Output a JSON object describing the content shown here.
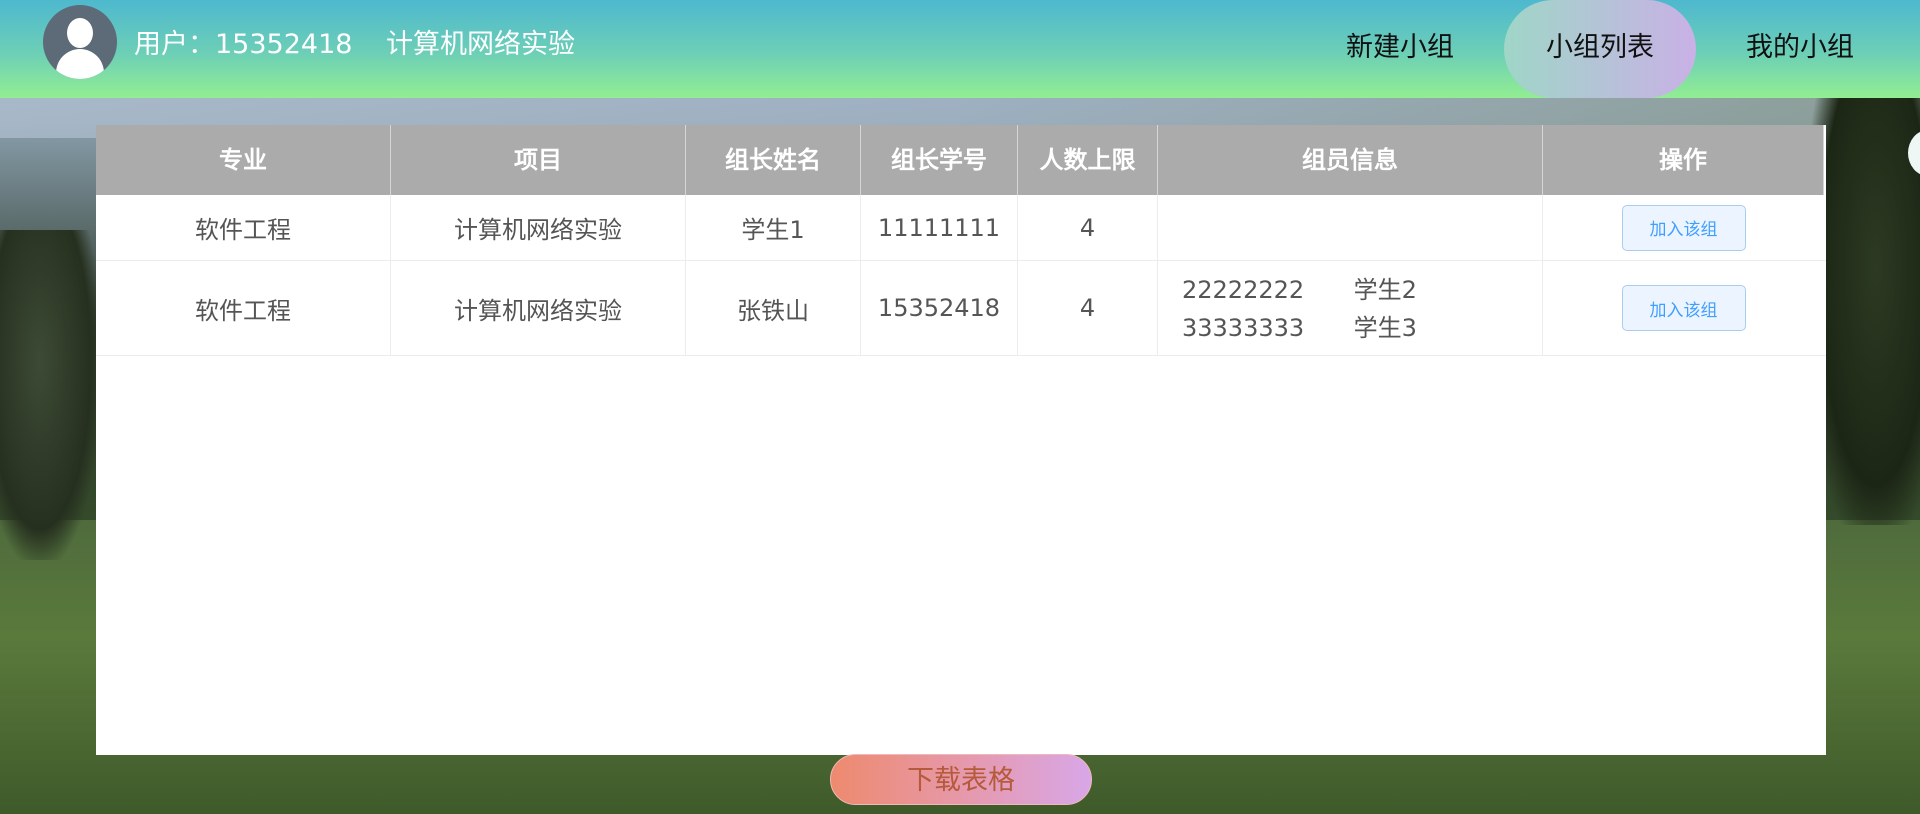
{
  "header": {
    "user_label": "用户：15352418",
    "project_label": "计算机网络实验",
    "nav": {
      "new_group": "新建小组",
      "group_list": "小组列表",
      "my_group": "我的小组"
    }
  },
  "table": {
    "columns": [
      "专业",
      "项目",
      "组长姓名",
      "组长学号",
      "人数上限",
      "组员信息",
      "操作"
    ],
    "rows": [
      {
        "major": "软件工程",
        "project": "计算机网络实验",
        "leader_name": "学生1",
        "leader_id": "11111111",
        "limit": "4",
        "members": [],
        "action": "加入该组"
      },
      {
        "major": "软件工程",
        "project": "计算机网络实验",
        "leader_name": "张铁山",
        "leader_id": "15352418",
        "limit": "4",
        "members": [
          {
            "id": "22222222",
            "name": "学生2"
          },
          {
            "id": "33333333",
            "name": "学生3"
          }
        ],
        "action": "加入该组"
      }
    ]
  },
  "download_label": "下载表格",
  "colors": {
    "header_top": "#4eb8cf",
    "header_bottom": "#92ee92",
    "table_head": "#ababab",
    "button_blue": "#409eff"
  }
}
